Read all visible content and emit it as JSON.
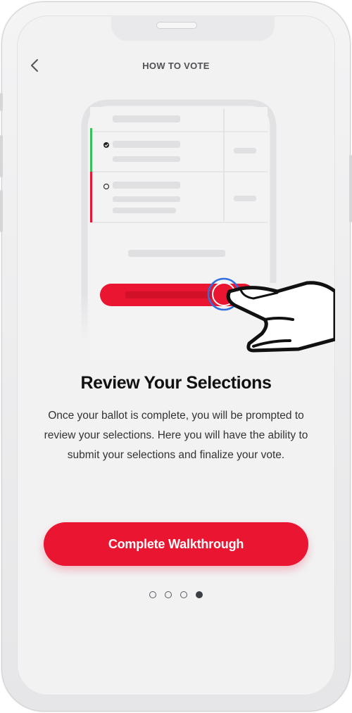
{
  "header": {
    "title": "HOW TO VOTE"
  },
  "slide": {
    "heading": "Review Your Selections",
    "body": "Once your ballot is complete, you will be prompted to review your selections.  Here you will have the ability to submit your selections and finalize your vote."
  },
  "cta": {
    "label": "Complete Walkthrough"
  },
  "pagination": {
    "total": 4,
    "active_index": 3
  },
  "colors": {
    "accent": "#ea1530",
    "approve": "#3bbf5c",
    "ring": "#2f6fe0"
  },
  "icons": [
    "back-chevron-icon",
    "checkmark-icon",
    "empty-radio-icon",
    "pointing-hand-icon"
  ]
}
